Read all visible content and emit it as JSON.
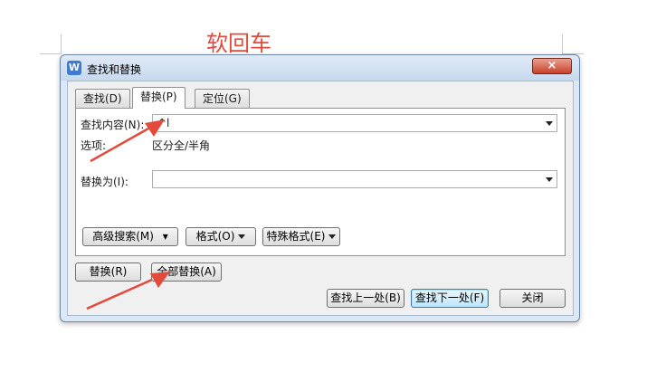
{
  "document": {
    "text": "软回车"
  },
  "dialog": {
    "title": "查找和替换",
    "app_icon": "W",
    "close_glyph": "×",
    "tabs": [
      {
        "label": "查找(D)",
        "active": false
      },
      {
        "label": "替换(P)",
        "active": true
      },
      {
        "label": "定位(G)",
        "active": false
      }
    ],
    "find": {
      "label": "查找内容(N):",
      "value": "^l"
    },
    "options": {
      "label": "选项:",
      "value": "区分全/半角"
    },
    "replace": {
      "label": "替换为(I):",
      "value": ""
    },
    "buttons": {
      "advanced": "高级搜索(M)",
      "advanced_arrow": "▾",
      "format": "格式(O)",
      "special": "特殊格式(E)",
      "replace": "替换(R)",
      "replace_all": "全部替换(A)",
      "find_prev": "查找上一处(B)",
      "find_next": "查找下一处(F)",
      "close": "关闭"
    }
  },
  "colors": {
    "annotation_red": "#e24a3b",
    "dialog_frame": "#dce8f6",
    "close_button": "#c8412b"
  }
}
